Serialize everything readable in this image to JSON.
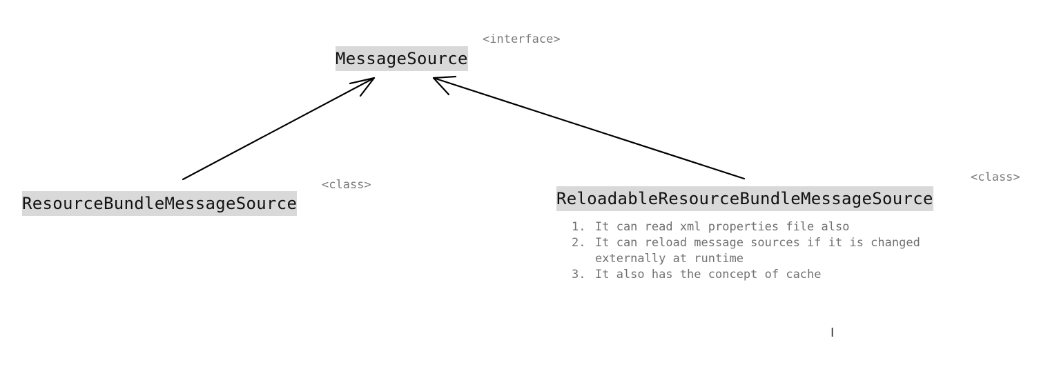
{
  "diagram": {
    "nodes": [
      {
        "id": "message-source",
        "label": "MessageSource",
        "stereotype": "<interface>"
      },
      {
        "id": "resource-bundle",
        "label": "ResourceBundleMessageSource",
        "stereotype": "<class>"
      },
      {
        "id": "reloadable",
        "label": "ReloadableResourceBundleMessageSource",
        "stereotype": "<class>"
      }
    ],
    "edges": [
      {
        "from": "resource-bundle",
        "to": "message-source"
      },
      {
        "from": "reloadable",
        "to": "message-source"
      }
    ],
    "notes": [
      {
        "num": "1.",
        "text": "It can read xml properties file also"
      },
      {
        "num": "2.",
        "text": "It can reload message sources if it is changed\nexternally at runtime"
      },
      {
        "num": "3.",
        "text": "It also has the concept of cache"
      }
    ]
  },
  "colors": {
    "label_background": "#d9d9d9",
    "stereotype_text": "#7a7a7a",
    "note_text": "#707070",
    "arrow": "#000000"
  }
}
